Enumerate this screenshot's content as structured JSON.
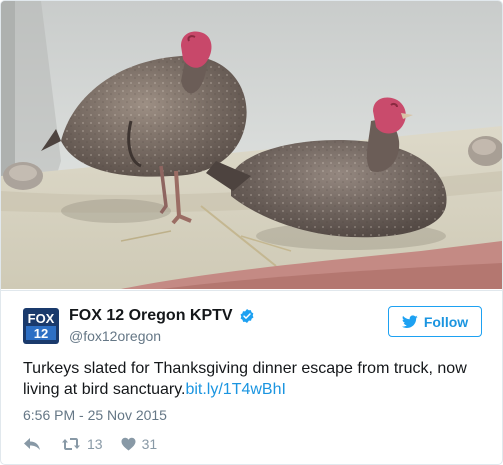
{
  "tweet": {
    "author_name": "FOX 12 Oregon KPTV",
    "handle": "@fox12oregon",
    "follow_label": "Follow",
    "text": "Turkeys slated for Thanksgiving dinner escape from truck, now living at bird sanctuary.",
    "link": "bit.ly/1T4wBhI",
    "timestamp": "6:56 PM - 25 Nov 2015",
    "retweet_count": "13",
    "like_count": "31"
  },
  "logo": {
    "line1": "FOX",
    "line2": "12"
  },
  "colors": {
    "accent": "#1da1f2",
    "text": "#14171a",
    "muted": "#657786",
    "icon": "#8899a6"
  },
  "icons": [
    "verified-badge-icon",
    "twitter-bird-icon",
    "reply-icon",
    "retweet-icon",
    "heart-icon"
  ]
}
